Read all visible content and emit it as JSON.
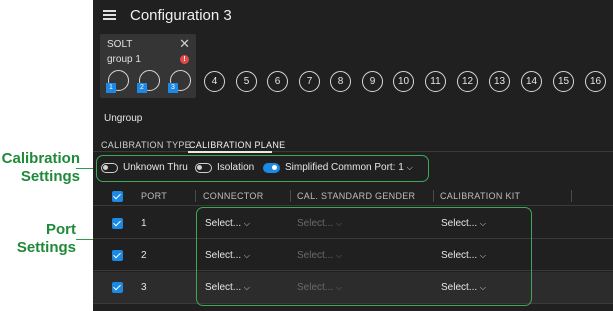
{
  "annotations": {
    "calibration_settings": [
      "Calibration",
      "Settings"
    ],
    "port_settings": [
      "Port",
      "Settings"
    ]
  },
  "header": {
    "title": "Configuration 3"
  },
  "group_card": {
    "name": "SOLT",
    "subtitle": "group 1",
    "close": "✕",
    "warning": "!"
  },
  "group_ports": [
    "1",
    "2",
    "3"
  ],
  "ports": [
    "4",
    "5",
    "6",
    "7",
    "8",
    "9",
    "10",
    "11",
    "12",
    "13",
    "14",
    "15",
    "16"
  ],
  "ungroup_label": "Ungroup",
  "tabs": [
    "CALIBRATION TYPE",
    "CALIBRATION PLANE"
  ],
  "settings": {
    "unknown_thru": {
      "label": "Unknown Thru",
      "on": false
    },
    "isolation": {
      "label": "Isolation",
      "on": false
    },
    "simplified": {
      "label": "Simplified",
      "on": true
    },
    "common_port": {
      "label": "Common Port: 1"
    }
  },
  "table": {
    "headers": [
      "PORT",
      "CONNECTOR",
      "CAL. STANDARD GENDER",
      "CALIBRATION KIT"
    ],
    "rows": [
      {
        "port": "1",
        "connector": "Select...",
        "gender": "Select...",
        "kit": "Select..."
      },
      {
        "port": "2",
        "connector": "Select...",
        "gender": "Select...",
        "kit": "Select..."
      },
      {
        "port": "3",
        "connector": "Select...",
        "gender": "Select...",
        "kit": "Select..."
      }
    ]
  },
  "colors": {
    "accent": "#1e88e5",
    "annotation": "#1f8a3a",
    "background": "#202020"
  }
}
